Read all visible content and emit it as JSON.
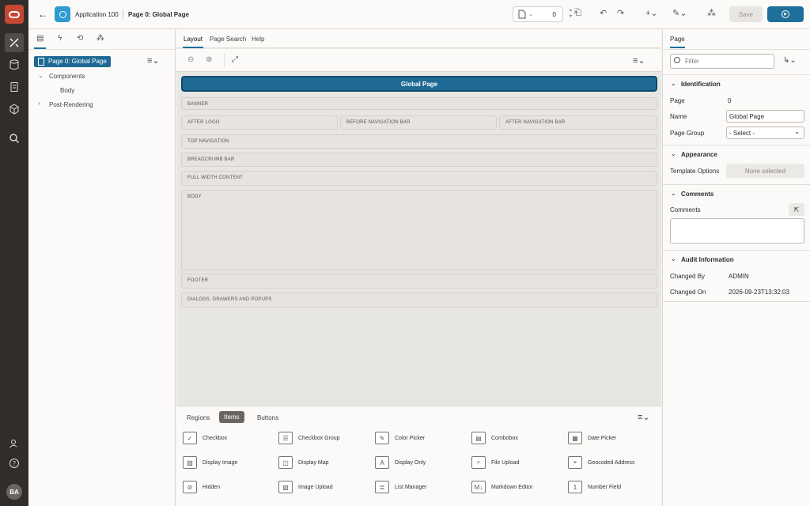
{
  "header": {
    "app_name": "Application 100",
    "page_name": "Page 0: Global Page",
    "page_number": "0",
    "save_label": "Save"
  },
  "left_panel": {
    "tree": {
      "selected": "Page 0: Global Page",
      "components": "Components",
      "body": "Body",
      "post_rendering": "Post-Rendering"
    }
  },
  "center": {
    "tabs": [
      "Layout",
      "Page Search",
      "Help"
    ],
    "global_page_label": "Global Page",
    "slots": {
      "banner": "BANNER",
      "after_logo": "AFTER LOGO",
      "before_nav": "BEFORE NAVIGATION BAR",
      "after_nav": "AFTER NAVIGATION BAR",
      "top_nav": "TOP NAVIGATION",
      "breadcrumb": "BREADCRUMB BAR",
      "full_width": "FULL WIDTH CONTENT",
      "body": "BODY",
      "footer": "FOOTER",
      "dialogs": "DIALOGS, DRAWERS AND POPUPS"
    },
    "gallery": {
      "tabs": [
        "Regions",
        "Items",
        "Buttons"
      ],
      "items": [
        "Checkbox",
        "Checkbox Group",
        "Color Picker",
        "Combobox",
        "Date Picker",
        "Display Image",
        "Display Map",
        "Display Only",
        "File Upload",
        "Geocoded Address",
        "Hidden",
        "Image Upload",
        "List Manager",
        "Markdown Editor",
        "Number Field"
      ]
    }
  },
  "right_panel": {
    "tab": "Page",
    "filter_placeholder": "Filter",
    "identification": {
      "title": "Identification",
      "page_label": "Page",
      "page_value": "0",
      "name_label": "Name",
      "name_value": "Global Page",
      "group_label": "Page Group",
      "group_value": "- Select -"
    },
    "appearance": {
      "title": "Appearance",
      "template_label": "Template Options",
      "template_value": "None selected"
    },
    "comments": {
      "title": "Comments",
      "label": "Comments"
    },
    "audit": {
      "title": "Audit Information",
      "changed_by_label": "Changed By",
      "changed_by_value": "ADMIN",
      "changed_on_label": "Changed On",
      "changed_on_value": "2026-09-23T13:32:03"
    }
  },
  "user": {
    "initials": "BA"
  },
  "colors": {
    "accent": "#1f6a94",
    "rail": "#312d2a",
    "brand": "#c74634"
  }
}
